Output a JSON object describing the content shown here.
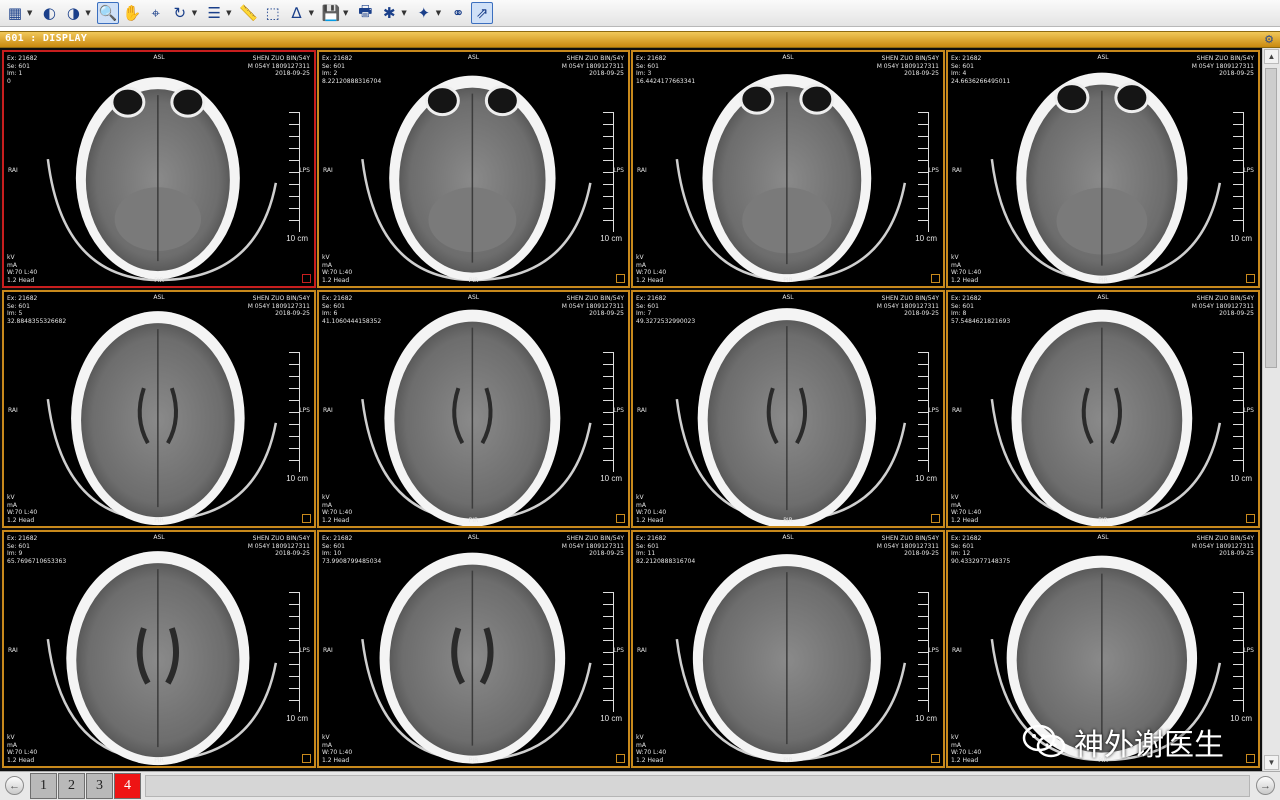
{
  "toolbar": {
    "buttons": [
      {
        "icon": "grid-layout-icon",
        "glyph": "▦",
        "dropdown": true
      },
      {
        "icon": "window-level-icon",
        "glyph": "◐",
        "dropdown": false
      },
      {
        "icon": "contrast-preset-icon",
        "glyph": "◑",
        "dropdown": true
      },
      {
        "icon": "zoom-icon",
        "glyph": "🔍",
        "dropdown": false,
        "active": true
      },
      {
        "icon": "pan-hand-icon",
        "glyph": "✋",
        "dropdown": false
      },
      {
        "icon": "magnify-tool-icon",
        "glyph": "⌖",
        "dropdown": false
      },
      {
        "icon": "rotate-icon",
        "glyph": "↻",
        "dropdown": true
      },
      {
        "icon": "series-stack-icon",
        "glyph": "☰",
        "dropdown": true
      },
      {
        "icon": "ruler-icon",
        "glyph": "📏",
        "dropdown": false
      },
      {
        "icon": "roi-select-icon",
        "glyph": "⬚",
        "dropdown": false
      },
      {
        "icon": "angle-measure-icon",
        "glyph": "∆",
        "dropdown": true
      },
      {
        "icon": "save-icon",
        "glyph": "💾",
        "dropdown": true
      },
      {
        "icon": "print-icon",
        "glyph": "🖶",
        "dropdown": false
      },
      {
        "icon": "brain-3d-icon",
        "glyph": "✱",
        "dropdown": true
      },
      {
        "icon": "magic-wand-icon",
        "glyph": "✦",
        "dropdown": true
      },
      {
        "icon": "network-icon",
        "glyph": "⚭",
        "dropdown": false
      },
      {
        "icon": "export-icon",
        "glyph": "⇗",
        "dropdown": false,
        "active": true
      }
    ]
  },
  "title_bar": {
    "title": "601 : DISPLAY",
    "config_icon": "settings-icon"
  },
  "viewer": {
    "common": {
      "exam": "Ex: 21682",
      "series": "Se: 601",
      "patient": "SHEN ZUO BIN/54Y",
      "patient_id": "M 054Y 1809127311",
      "date": "2018-09-25",
      "anterior": "ASL",
      "posterior": "PIR",
      "right_side": "RAI",
      "left_side": "LPS",
      "kv": "kV",
      "ma": "mA",
      "window": "W:70 L:40",
      "slice": "1.2 Head",
      "scale": "10 cm"
    },
    "images": [
      {
        "im": "Im: 1",
        "pos": "0",
        "selected": true,
        "level": 0
      },
      {
        "im": "Im: 2",
        "pos": "8.22120888316704",
        "level": 1
      },
      {
        "im": "Im: 3",
        "pos": "16.4424177663341",
        "level": 2
      },
      {
        "im": "Im: 4",
        "pos": "24.6636266495011",
        "level": 3
      },
      {
        "im": "Im: 5",
        "pos": "32.8848355326682",
        "level": 4
      },
      {
        "im": "Im: 6",
        "pos": "41.1060444158352",
        "level": 5
      },
      {
        "im": "Im: 7",
        "pos": "49.3272532990023",
        "level": 6
      },
      {
        "im": "Im: 8",
        "pos": "57.5484621821693",
        "level": 7
      },
      {
        "im": "Im: 9",
        "pos": "65.7696710653363",
        "level": 8
      },
      {
        "im": "Im: 10",
        "pos": "73.9908799485034",
        "level": 9
      },
      {
        "im": "Im: 11",
        "pos": "82.2120888316704",
        "level": 10
      },
      {
        "im": "Im: 12",
        "pos": "90.4332977148375",
        "level": 11
      }
    ]
  },
  "pager": {
    "prev_icon": "previous-arrow-icon",
    "next_icon": "next-arrow-icon",
    "pages": [
      "1",
      "2",
      "3",
      "4"
    ],
    "current": "4"
  },
  "watermark": {
    "text": "神外谢医生",
    "logo_icon": "wechat-logo-icon"
  }
}
